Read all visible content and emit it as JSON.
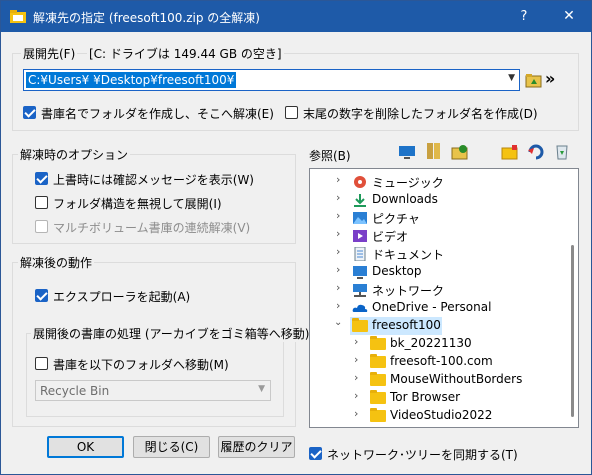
{
  "window": {
    "title": "解凍先の指定 (freesoft100.zip の全解凍)",
    "help_label": "?",
    "close_label": "✕"
  },
  "destination": {
    "label": "展開先(F)",
    "drive_info": "[C: ドライブは 149.44 GB の空き]",
    "path_value": "C:¥Users¥          ¥Desktop¥freesoft100¥",
    "more_label": "»"
  },
  "options_top": {
    "create_folder_label": "書庫名でフォルダを作成し、そこへ解凍(E)",
    "create_folder_checked": true,
    "strip_number_label": "末尾の数字を削除したフォルダ名を作成(D)",
    "strip_number_checked": false
  },
  "extract_options": {
    "title": "解凍時のオプション",
    "items": [
      {
        "label": "上書時には確認メッセージを表示(W)",
        "checked": true,
        "disabled": false
      },
      {
        "label": "フォルダ構造を無視して展開(I)",
        "checked": false,
        "disabled": false
      },
      {
        "label": "マルチボリューム書庫の連続解凍(V)",
        "checked": false,
        "disabled": true
      }
    ]
  },
  "after_actions": {
    "title": "解凍後の動作",
    "explorer_label": "エクスプローラを起動(A)",
    "explorer_checked": true,
    "archive_group": {
      "title": "展開後の書庫の処理 (アーカイブをゴミ箱等へ移動)",
      "move_label": "書庫を以下のフォルダへ移動(M)",
      "move_checked": false,
      "folder_value": "Recycle Bin"
    }
  },
  "browse": {
    "label": "参照(B)",
    "tree": [
      {
        "label": "ミュージック",
        "level": 0,
        "icon": "music-icon",
        "expanded": false
      },
      {
        "label": "Downloads",
        "level": 0,
        "icon": "download-icon",
        "expanded": false
      },
      {
        "label": "ピクチャ",
        "level": 0,
        "icon": "pictures-icon",
        "expanded": false
      },
      {
        "label": "ビデオ",
        "level": 0,
        "icon": "video-icon",
        "expanded": false
      },
      {
        "label": "ドキュメント",
        "level": 0,
        "icon": "documents-icon",
        "expanded": false
      },
      {
        "label": "Desktop",
        "level": 0,
        "icon": "desktop-icon",
        "expanded": false
      },
      {
        "label": "ネットワーク",
        "level": 0,
        "icon": "network-icon",
        "expanded": false
      },
      {
        "label": "OneDrive - Personal",
        "level": 0,
        "icon": "onedrive-icon",
        "expanded": false
      },
      {
        "label": "freesoft100",
        "level": 0,
        "icon": "folder-icon",
        "expanded": true,
        "selected": true
      },
      {
        "label": "bk_20221130",
        "level": 1,
        "icon": "folder-icon",
        "expanded": false
      },
      {
        "label": "freesoft-100.com",
        "level": 1,
        "icon": "folder-icon",
        "expanded": false
      },
      {
        "label": "MouseWithoutBorders",
        "level": 1,
        "icon": "folder-icon",
        "expanded": false
      },
      {
        "label": "Tor Browser",
        "level": 1,
        "icon": "folder-icon",
        "expanded": false
      },
      {
        "label": "VideoStudio2022",
        "level": 1,
        "icon": "folder-icon",
        "expanded": false
      }
    ],
    "sync_label": "ネットワーク･ツリーを同期する(T)",
    "sync_checked": true
  },
  "buttons": {
    "ok_label": "OK",
    "close_label": "閉じる(C)",
    "clear_history_label": "履歴のクリア"
  },
  "colors": {
    "titlebar": "#1e5aa8",
    "accent": "#0078d7",
    "selection": "#cce8ff"
  }
}
